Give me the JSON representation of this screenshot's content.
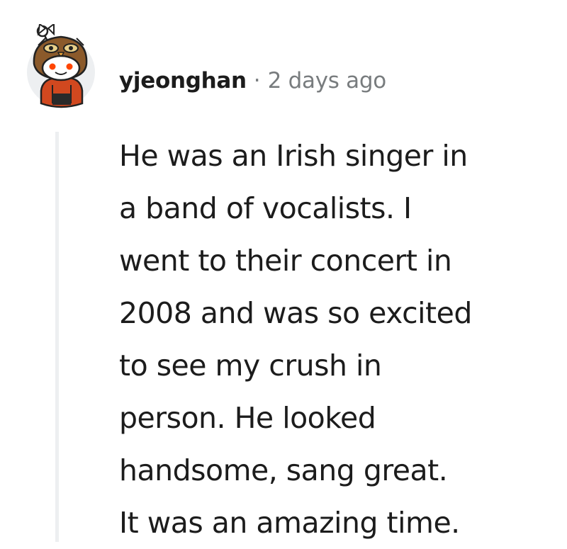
{
  "comment": {
    "author": {
      "username": "yjeonghan",
      "avatar_icon": "owl-hood-snoo-avatar-icon"
    },
    "separator": "·",
    "timestamp": "2 days ago",
    "body_lines": [
      "He was an Irish singer in",
      "a band of vocalists. I",
      "went to their concert in",
      "2008 and was so excited",
      "to see my crush in",
      "person. He looked",
      "handsome, sang great.",
      "It was an amazing time."
    ],
    "colors": {
      "text": "#1c1c1c",
      "meta": "#787c7e",
      "thread_line": "#edeff1",
      "avatar_hood": "#8b5a2b",
      "avatar_shirt": "#d1481f"
    }
  }
}
